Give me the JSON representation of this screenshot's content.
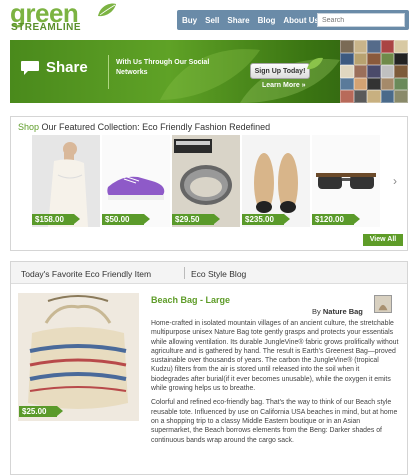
{
  "logo": {
    "word1": "green",
    "word2": "STREAMLINE"
  },
  "nav": {
    "items": [
      "Buy",
      "Sell",
      "Share",
      "Blog",
      "About Us"
    ],
    "search_placeholder": "Search"
  },
  "banner": {
    "title": "Share",
    "tagline": "With Us Through Our Social Networks",
    "signup_label": "Sign Up Today!",
    "learn_more": "Learn More »"
  },
  "shop": {
    "title_prefix": "Shop",
    "title_rest": "Our Featured Collection: Eco Friendly Fashion Redefined",
    "products": [
      {
        "price": "$158.00",
        "icon": "dress-image"
      },
      {
        "price": "$50.00",
        "icon": "sneaker-image"
      },
      {
        "price": "$29.50",
        "icon": "ring-image"
      },
      {
        "price": "$235.00",
        "icon": "shoes-image"
      },
      {
        "price": "$120.00",
        "icon": "sunglasses-image"
      }
    ],
    "view_all": "View All"
  },
  "favorites": {
    "tab1": "Today's Favorite Eco Friendly Item",
    "tab2": "Eco Style Blog",
    "item": {
      "title": "Beach Bag - Large",
      "by": "By",
      "author": "Nature Bag",
      "price": "$25.00",
      "desc1": "Home-crafted in isolated mountain villages of an ancient culture, the stretchable multipurpose unisex Nature Bag tote gently grasps and protects your essentials while allowing ventilation. Its durable JungleVine® fabric grows prolifically without agriculture and is gathered by hand. The result is Earth's Greenest Bag—proved sustainable over thousands of years. The carbon the JungleVine® (tropical Kudzu) filters from the air is stored until released into the soil when it biodegrades after burial(if it ever becomes unusable), while the oxygen it emits while growing helps us to breathe.",
      "desc2": "Colorful and refined eco-friendly bag. That's the way to think of our Beach style reusable tote. Influenced by use on California USA beaches in mind, but at home on a shopping trip to a classy Middle Eastern boutique or in an Asian supermarket, the Beach borrows elements from the Beng: Darker shades of continuous bands wrap around the cargo sack."
    }
  },
  "colors": {
    "brand_green": "#5e9c28",
    "nav_blue": "#6a8ba8",
    "price_green": "#5a9a2a"
  }
}
